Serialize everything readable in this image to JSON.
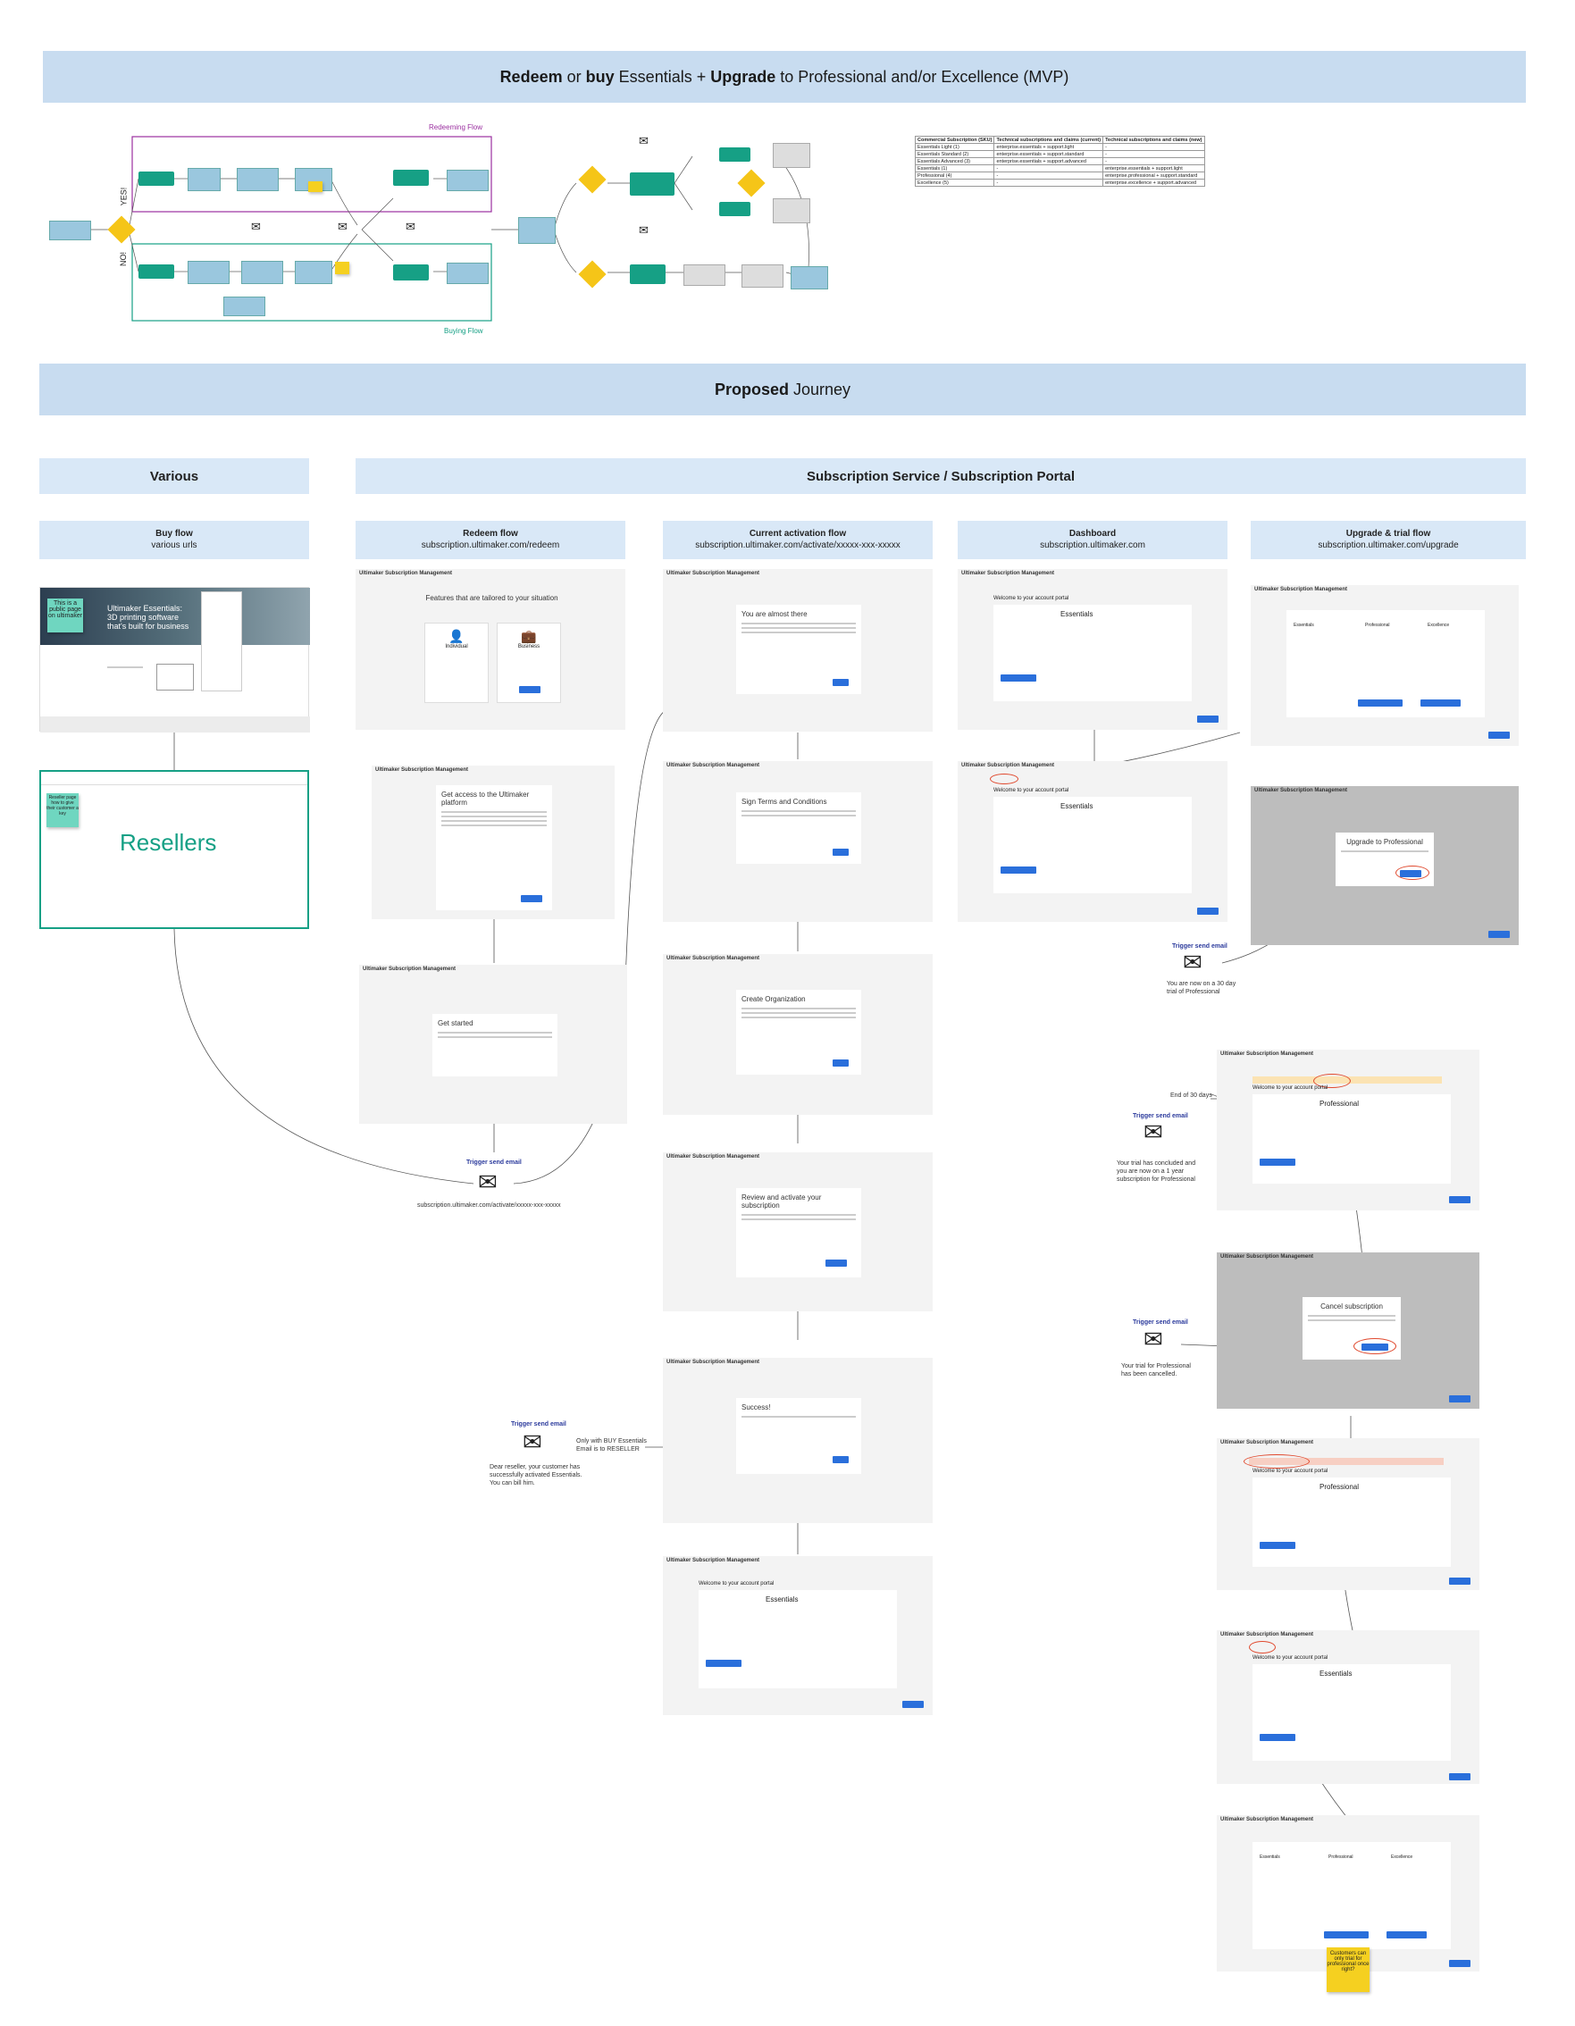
{
  "header": {
    "b1": "Redeem",
    "t1": "or",
    "b2": "buy",
    "t2": "Essentials +",
    "b3": "Upgrade",
    "t3": "to Professional and/or Excellence (MVP)"
  },
  "flow": {
    "redeeming_label": "Redeeming Flow",
    "buying_label": "Buying Flow",
    "yes_label": "YES!",
    "no_label": "NO!"
  },
  "mvp_table": {
    "headers": [
      "Commercial Subscription (SKU)",
      "Technical subscriptions and claims (current)",
      "Technical subscriptions and claims (new)"
    ],
    "rows": [
      [
        "Essentials Light (1)",
        "enterprise.essentials + support.light",
        "-"
      ],
      [
        "Essentials Standard (2)",
        "enterprise.essentials + support.standard",
        "-"
      ],
      [
        "Essentials Advanced (3)",
        "enterprise.essentials + support.advanced",
        "-"
      ],
      [
        "Essentials (1)",
        "-",
        "enterprise.essentials + support.light"
      ],
      [
        "Professional (4)",
        "-",
        "enterprise.professional + support.standard"
      ],
      [
        "Excellence (5)",
        "-",
        "enterprise.excellence + support.advanced"
      ]
    ]
  },
  "proposed": {
    "b": "Proposed",
    "t": "Journey"
  },
  "various": {
    "title": "Various",
    "buy_title": "Buy flow",
    "buy_sub": "various urls"
  },
  "portal_title": "Subscription Service / Subscription Portal",
  "columns": [
    {
      "title": "Redeem flow",
      "sub": "subscription.ultimaker.com/redeem"
    },
    {
      "title": "Current activation flow",
      "sub": "subscription.ultimaker.com/activate/xxxxx-xxx-xxxxx"
    },
    {
      "title": "Dashboard",
      "sub": "subscription.ultimaker.com"
    },
    {
      "title": "Upgrade & trial flow",
      "sub": "subscription.ultimaker.com/upgrade"
    }
  ],
  "app_name": "Ultimaker Subscription Management",
  "buy_page": {
    "sticky": "This is a public page on ultimaker",
    "hero": "Ultimaker Essentials: 3D printing software that's built for business"
  },
  "resellers": {
    "label": "Resellers",
    "sticky": "Reseller page how to give their customer a key"
  },
  "redeem_screens": [
    {
      "title": "Features that are tailored to your situation",
      "opt1": "Individual",
      "opt2": "Business"
    },
    {
      "title": "Get access to the Ultimaker platform"
    },
    {
      "title": "Get started"
    }
  ],
  "activation_screens": [
    {
      "title": "You are almost there"
    },
    {
      "title": "Sign Terms and Conditions"
    },
    {
      "title": "Create Organization"
    },
    {
      "title": "Review and activate your subscription"
    },
    {
      "title": "Success!"
    },
    {
      "title": "Welcome to your account portal",
      "plan": "Essentials"
    }
  ],
  "dashboard_screens": [
    {
      "title": "Welcome to your account portal",
      "plan": "Essentials"
    },
    {
      "title": "Welcome to your account portal",
      "plan": "Essentials"
    }
  ],
  "upgrade_screens": [
    {
      "plans": [
        "Essentials",
        "Professional",
        "Excellence"
      ]
    },
    {
      "modal": "Upgrade to Professional"
    },
    {
      "title": "Welcome to your account portal",
      "plan": "Professional"
    },
    {
      "modal": "Cancel subscription"
    },
    {
      "title": "Welcome to your account portal",
      "plan": "Professional"
    },
    {
      "title": "Welcome to your account portal",
      "plan": "Essentials"
    },
    {
      "plans": [
        "Essentials",
        "Professional",
        "Excellence"
      ]
    }
  ],
  "emails": {
    "trigger": "Trigger send email",
    "redeem_url": "subscription.ultimaker.com/activate/xxxxx-xxx-xxxxx",
    "reseller_note": "Only with BUY Essentials Email is to RESELLER",
    "reseller_body": "Dear reseller, your customer has successfully activated Essentials. You can bill him.",
    "trial_note": "You are now on a 30 day trial of Professional",
    "end_label": "End of 30 days",
    "concluded_note": "Your trial has concluded and you are now on a 1 year subscription for Professional",
    "cancelled_note": "Your trial for Professional has been cancelled."
  },
  "final_sticky": "Customers can only trial for professional once right?",
  "colors": {
    "band": "#c8dcf0",
    "head": "#d9e8f7",
    "teal": "#16a085",
    "blue": "#2a6fdb",
    "yellow": "#f5d020"
  }
}
